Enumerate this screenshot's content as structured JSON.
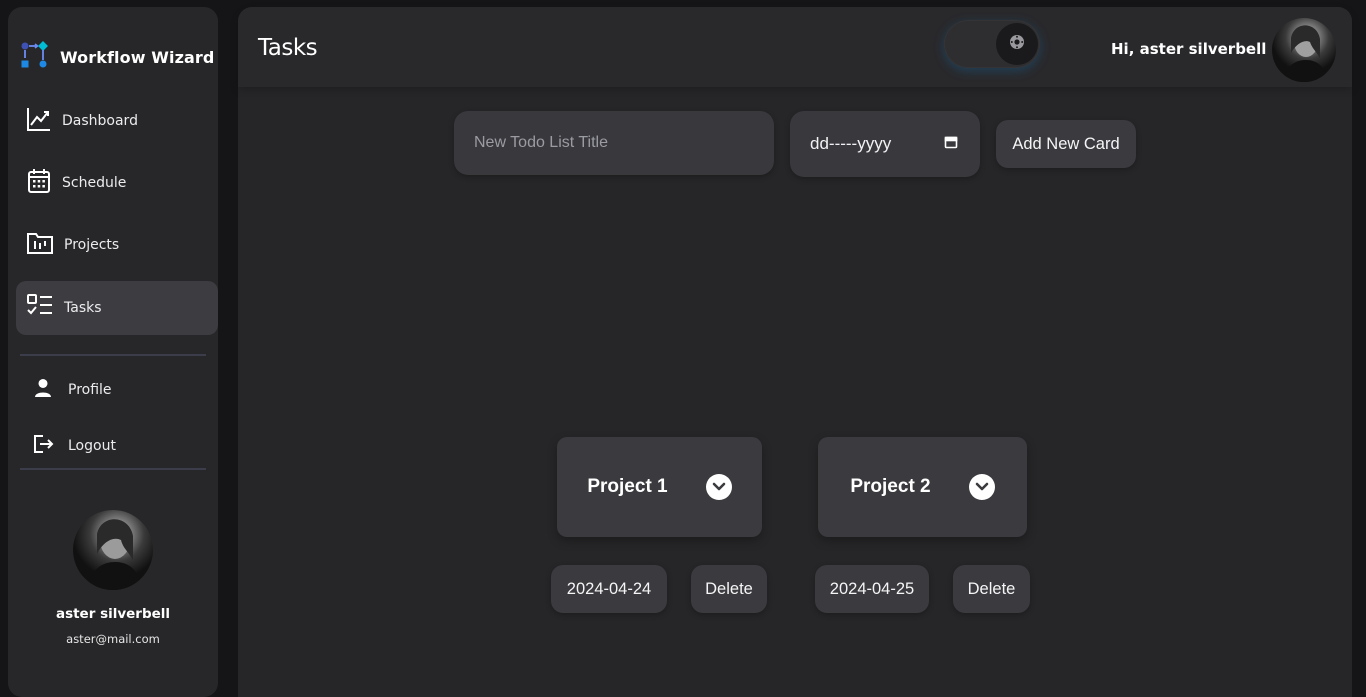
{
  "app": {
    "name": "Workflow Wizard"
  },
  "sidebar": {
    "items": [
      {
        "label": "Dashboard",
        "icon": "chart-line-icon"
      },
      {
        "label": "Schedule",
        "icon": "calendar-icon"
      },
      {
        "label": "Projects",
        "icon": "folder-chart-icon"
      },
      {
        "label": "Tasks",
        "icon": "task-list-icon",
        "active": true
      }
    ],
    "sub_items": [
      {
        "label": "Profile",
        "icon": "person-icon"
      },
      {
        "label": "Logout",
        "icon": "logout-icon"
      }
    ],
    "profile": {
      "name": "aster silverbell",
      "email": "aster@mail.com"
    }
  },
  "header": {
    "title": "Tasks",
    "greeting": "Hi, aster silverbell"
  },
  "form": {
    "title_placeholder": "New Todo List Title",
    "date_placeholder": "dd-----yyyy",
    "add_button": "Add New Card"
  },
  "cards": [
    {
      "title": "Project 1",
      "date": "2024-04-24",
      "delete_label": "Delete"
    },
    {
      "title": "Project 2",
      "date": "2024-04-25",
      "delete_label": "Delete"
    }
  ],
  "colors": {
    "background": "#151517",
    "panel": "#272729",
    "surface": "#3a3a3f",
    "accent_blue": "#1e88e5",
    "accent_navy": "#3f51b5",
    "accent_cyan": "#00bcd4"
  }
}
